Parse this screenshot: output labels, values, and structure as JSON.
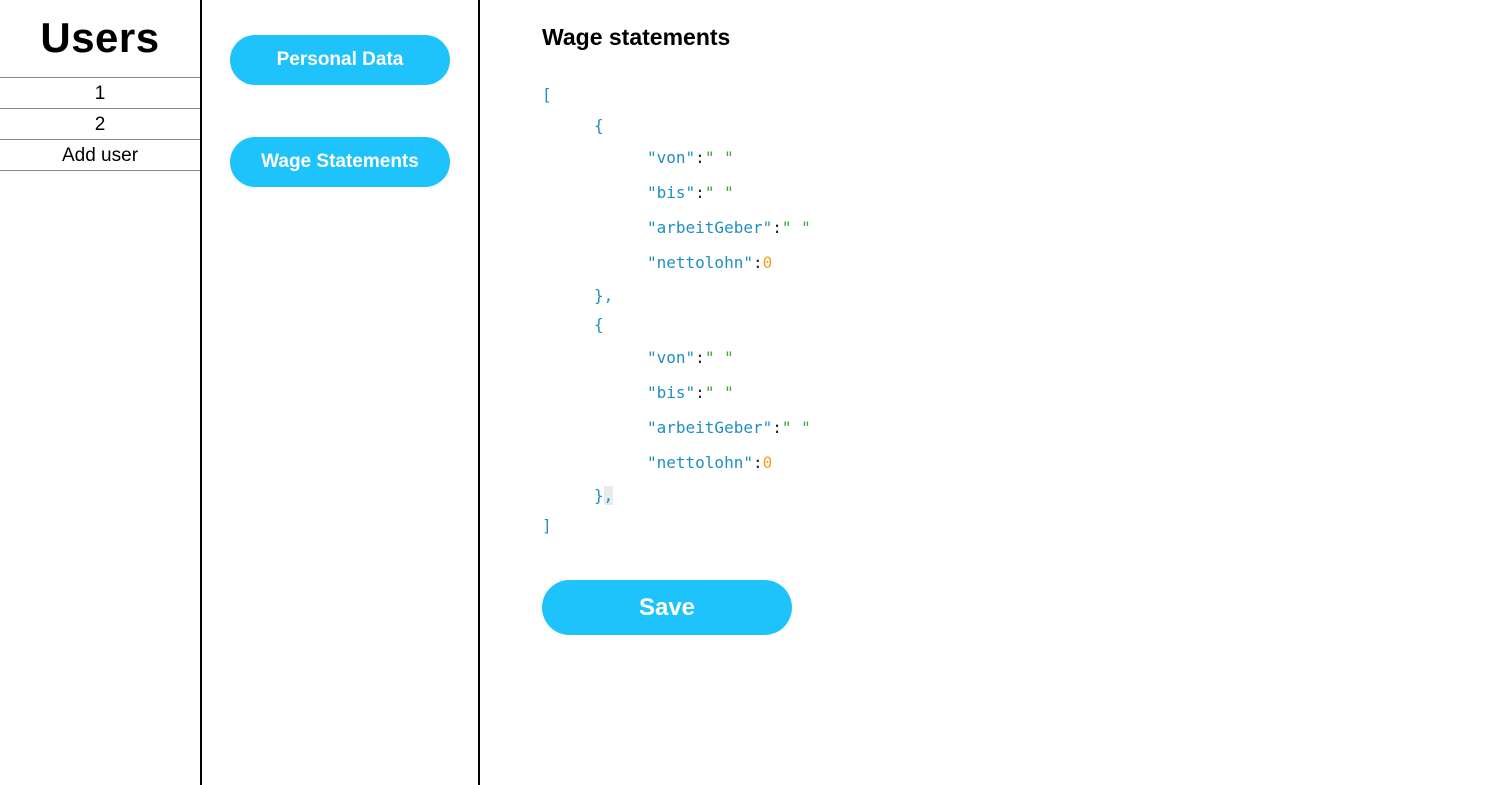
{
  "users": {
    "title": "Users",
    "items": [
      {
        "label": "1"
      },
      {
        "label": "2"
      },
      {
        "label": "Add user"
      }
    ]
  },
  "nav": {
    "personal_label": "Personal Data",
    "wage_label": "Wage Statements"
  },
  "main": {
    "title": "Wage statements",
    "save_label": "Save",
    "json": {
      "open_bracket": "[",
      "close_bracket": "]",
      "open_brace": "{",
      "close_brace": "}",
      "comma": ",",
      "colon": ":",
      "empty_string": "\" \"",
      "entries": [
        {
          "von_key": "\"von\"",
          "bis_key": "\"bis\"",
          "arbeitgeber_key": "\"arbeitGeber\"",
          "nettolohn_key": "\"nettolohn\"",
          "nettolohn_value": "0"
        },
        {
          "von_key": "\"von\"",
          "bis_key": "\"bis\"",
          "arbeitgeber_key": "\"arbeitGeber\"",
          "nettolohn_key": "\"nettolohn\"",
          "nettolohn_value": "0"
        }
      ]
    }
  },
  "colors": {
    "accent": "#1fc3fb",
    "json_key": "#1d8fc4",
    "json_string": "#3aa63a",
    "json_number": "#f0a21c"
  }
}
